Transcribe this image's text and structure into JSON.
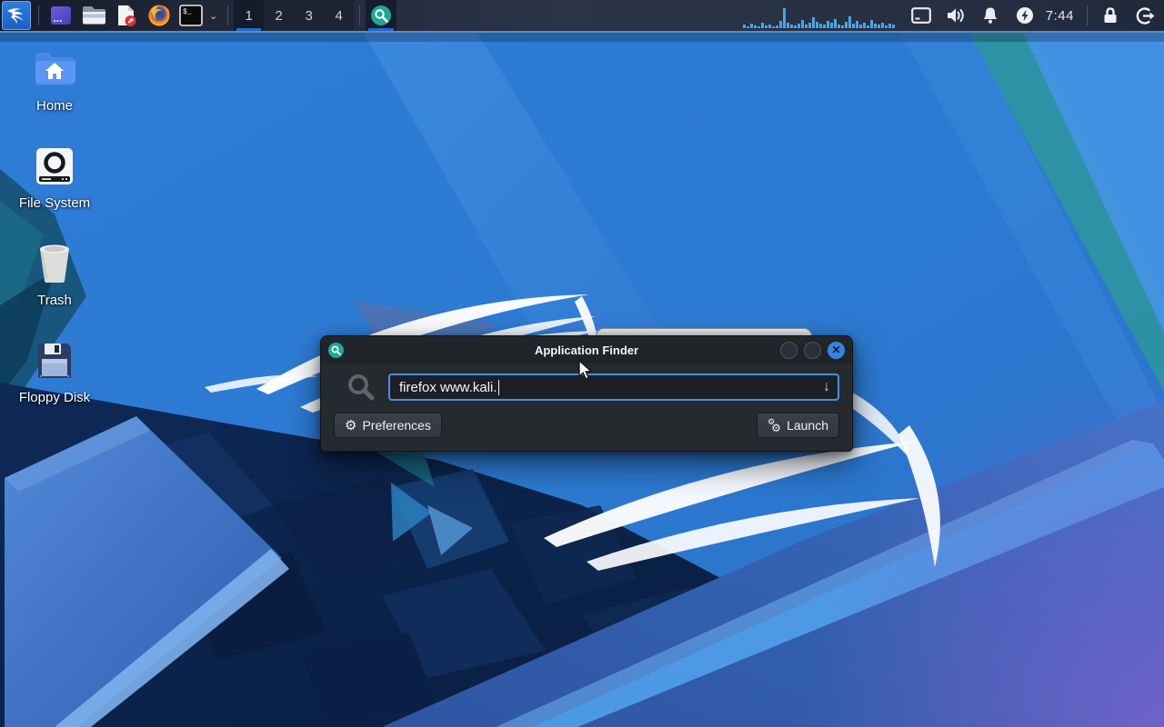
{
  "panel": {
    "kali_menu_icon": "kali-dragon-logo",
    "launchers": [
      {
        "icon": "app-menu-purple-icon"
      },
      {
        "icon": "file-manager-icon"
      },
      {
        "icon": "text-editor-icon"
      },
      {
        "icon": "firefox-icon"
      },
      {
        "icon": "terminal-icon"
      }
    ],
    "terminal_dropdown": "⌄",
    "workspaces": {
      "items": [
        "1",
        "2",
        "3",
        "4"
      ],
      "active": "1"
    },
    "taskbar_windows": [
      {
        "icon": "application-finder-icon",
        "active": true
      }
    ],
    "cpu_graph": {
      "bars": [
        4,
        2,
        5,
        3,
        2,
        6,
        3,
        4,
        2,
        3,
        8,
        22,
        6,
        4,
        3,
        5,
        9,
        4,
        6,
        12,
        7,
        5,
        4,
        8,
        6,
        10,
        4,
        3,
        7,
        13,
        5,
        8,
        4,
        6,
        3,
        9,
        5,
        4,
        6,
        3,
        5,
        4
      ]
    },
    "tray_icons": [
      "display-icon",
      "volume-icon",
      "notifications-icon",
      "power-manager-icon"
    ],
    "clock": "7:44",
    "session_icons": [
      "lock-icon",
      "logout-icon"
    ]
  },
  "desktop": {
    "icons": [
      {
        "label": "Home",
        "icon": "home-folder-icon"
      },
      {
        "label": "File System",
        "icon": "filesystem-drive-icon"
      },
      {
        "label": "Trash",
        "icon": "trash-icon"
      },
      {
        "label": "Floppy Disk",
        "icon": "floppy-disk-icon"
      }
    ]
  },
  "finder_window": {
    "title": "Application Finder",
    "window_icon": "application-finder-icon",
    "search": {
      "value": "firefox www.kali.",
      "dropdown_arrow": "↓"
    },
    "buttons": {
      "preferences": "Preferences",
      "launch": "Launch"
    },
    "titlebar_buttons": [
      "minimize",
      "maximize",
      "close"
    ],
    "close_glyph": "✕"
  },
  "colors": {
    "accent_blue": "#3584e4",
    "input_border": "#4a90d9",
    "panel_underline": "#2468cf",
    "panel_border_bottom": "#5d89c8",
    "finder_teal": "#1fa898",
    "cpu_bar": "#4aa3e8"
  }
}
